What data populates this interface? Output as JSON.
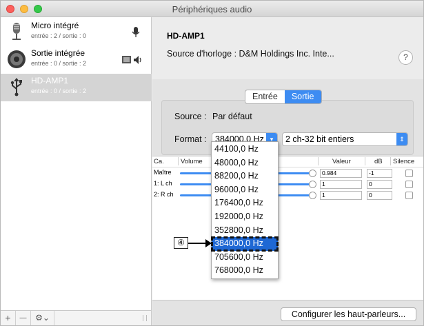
{
  "window": {
    "title": "Périphériques audio"
  },
  "sidebar": {
    "devices": [
      {
        "name": "Micro intégré",
        "io": "entrée : 2 / sortie : 0",
        "icon": "microphone-icon",
        "badge": "microphone-badge-icon"
      },
      {
        "name": "Sortie intégrée",
        "io": "entrée : 0 / sortie : 2",
        "icon": "speaker-icon",
        "badge": "speaker-output-badge-icon"
      },
      {
        "name": "HD-AMP1",
        "io": "entrée : 0 / sortie : 2",
        "icon": "usb-icon",
        "selected": true
      }
    ],
    "footer": {
      "add": "+",
      "remove": "—",
      "gear": "⚙︎⌄"
    }
  },
  "main": {
    "device_title": "HD-AMP1",
    "clock_source": "Source d'horloge : D&M Holdings Inc. Inte...",
    "help": "?",
    "tabs": [
      {
        "label": "Entrée",
        "active": false
      },
      {
        "label": "Sortie",
        "active": true
      }
    ],
    "source_label": "Source :",
    "source_value": "Par défaut",
    "format_label": "Format :",
    "format_rate": "384000,0 Hz",
    "format_bits": "2 ch-32 bit entiers",
    "table": {
      "headers": [
        "Ca.",
        "Volume",
        "Valeur",
        "dB",
        "Silence"
      ],
      "rows": [
        {
          "channel": "Maître",
          "value": "0.984",
          "db": "-1"
        },
        {
          "channel": "1: L ch",
          "value": "1",
          "db": "0"
        },
        {
          "channel": "2: R ch",
          "value": "1",
          "db": "0"
        }
      ]
    },
    "configure_button": "Configurer les haut-parleurs..."
  },
  "dropdown": {
    "options": [
      "44100,0 Hz",
      "48000,0 Hz",
      "88200,0 Hz",
      "96000,0 Hz",
      "176400,0 Hz",
      "192000,0 Hz",
      "352800,0 Hz",
      "384000,0 Hz",
      "705600,0 Hz",
      "768000,0 Hz"
    ],
    "highlighted": "384000,0 Hz"
  },
  "callout": {
    "label": "④"
  },
  "colors": {
    "accent": "#3d8cf2",
    "highlight": "#1f68d4",
    "selected_row": "#d4d4d4"
  }
}
